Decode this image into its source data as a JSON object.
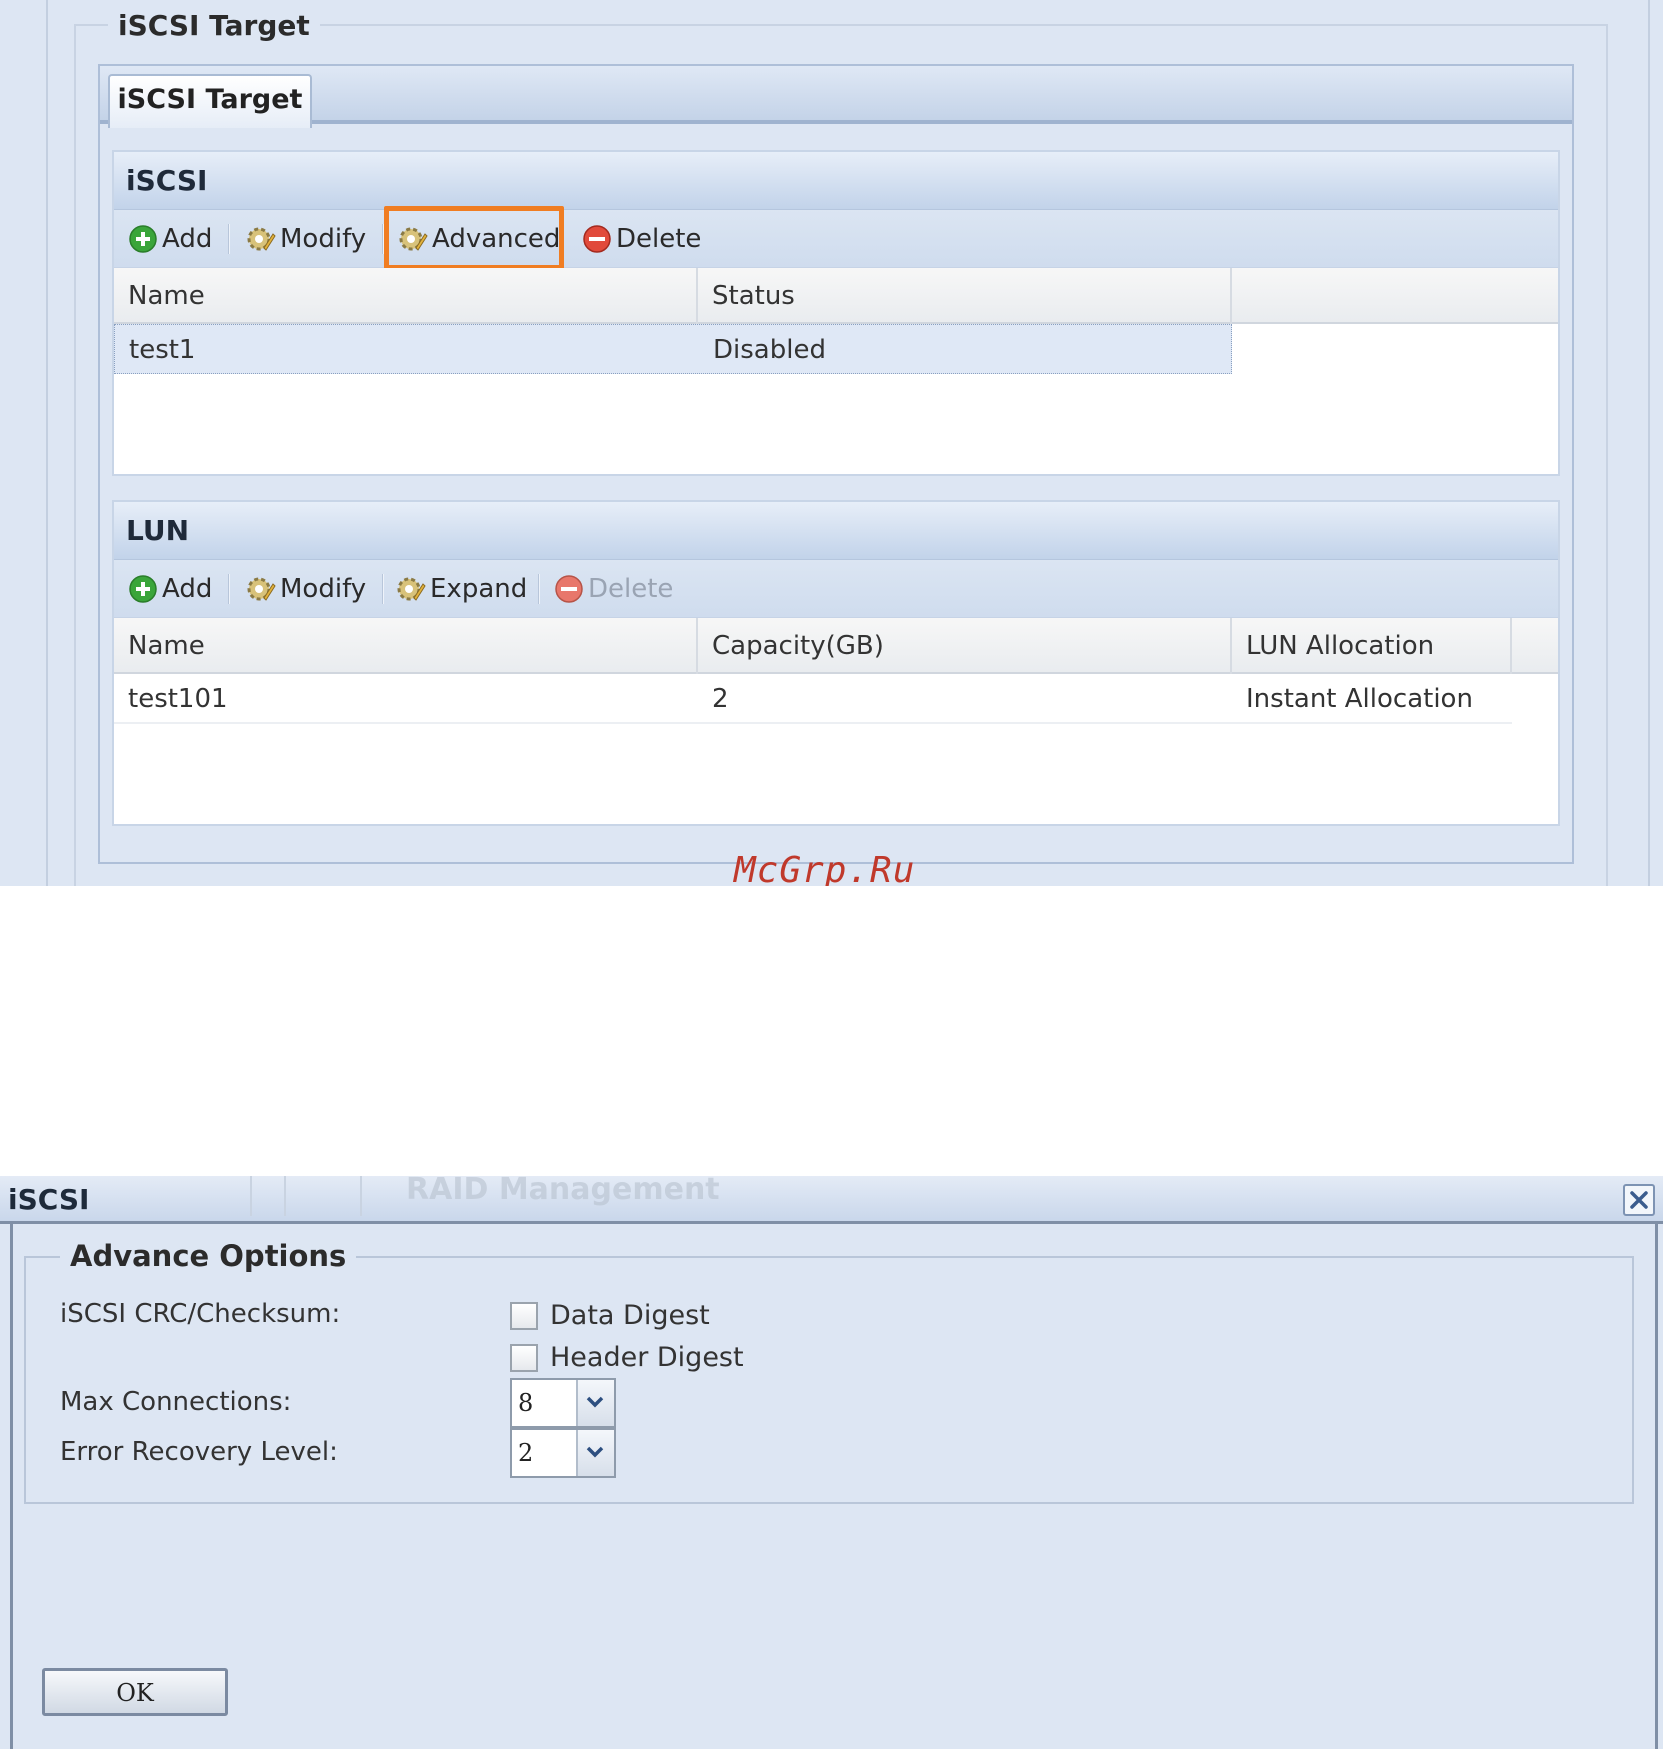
{
  "top_panel": {
    "fieldset_legend": "iSCSI Target",
    "tab_label": "iSCSI Target",
    "iscsi_grid": {
      "title": "iSCSI",
      "toolbar": {
        "add": "Add",
        "modify": "Modify",
        "advanced": "Advanced",
        "delete": "Delete"
      },
      "columns": [
        "Name",
        "Status"
      ],
      "rows": [
        {
          "name": "test1",
          "status": "Disabled"
        }
      ]
    },
    "lun_grid": {
      "title": "LUN",
      "toolbar": {
        "add": "Add",
        "modify": "Modify",
        "expand": "Expand",
        "delete": "Delete"
      },
      "columns": [
        "Name",
        "Capacity(GB)",
        "LUN Allocation"
      ],
      "rows": [
        {
          "name": "test101",
          "capacity": "2",
          "allocation": "Instant Allocation"
        }
      ]
    },
    "watermark": "McGrp.Ru"
  },
  "dialog": {
    "title": "iSCSI",
    "background_text": "RAID Management",
    "legend": "Advance Options",
    "crc_label": "iSCSI CRC/Checksum:",
    "data_digest_label": "Data Digest",
    "header_digest_label": "Header Digest",
    "data_digest_checked": false,
    "header_digest_checked": false,
    "max_connections_label": "Max Connections:",
    "max_connections_value": "8",
    "error_recovery_label": "Error Recovery Level:",
    "error_recovery_value": "2",
    "ok_label": "OK"
  },
  "colors": {
    "highlight": "#f07d22",
    "add_icon": "#3aa53a",
    "delete_icon": "#e14a3b",
    "watermark": "#c0392b"
  },
  "icons": {
    "add": "add-icon",
    "modify": "gear-icon",
    "advanced": "gear-icon",
    "expand": "gear-icon",
    "delete": "delete-icon",
    "close": "close-icon",
    "dropdown": "chevron-down-icon"
  }
}
